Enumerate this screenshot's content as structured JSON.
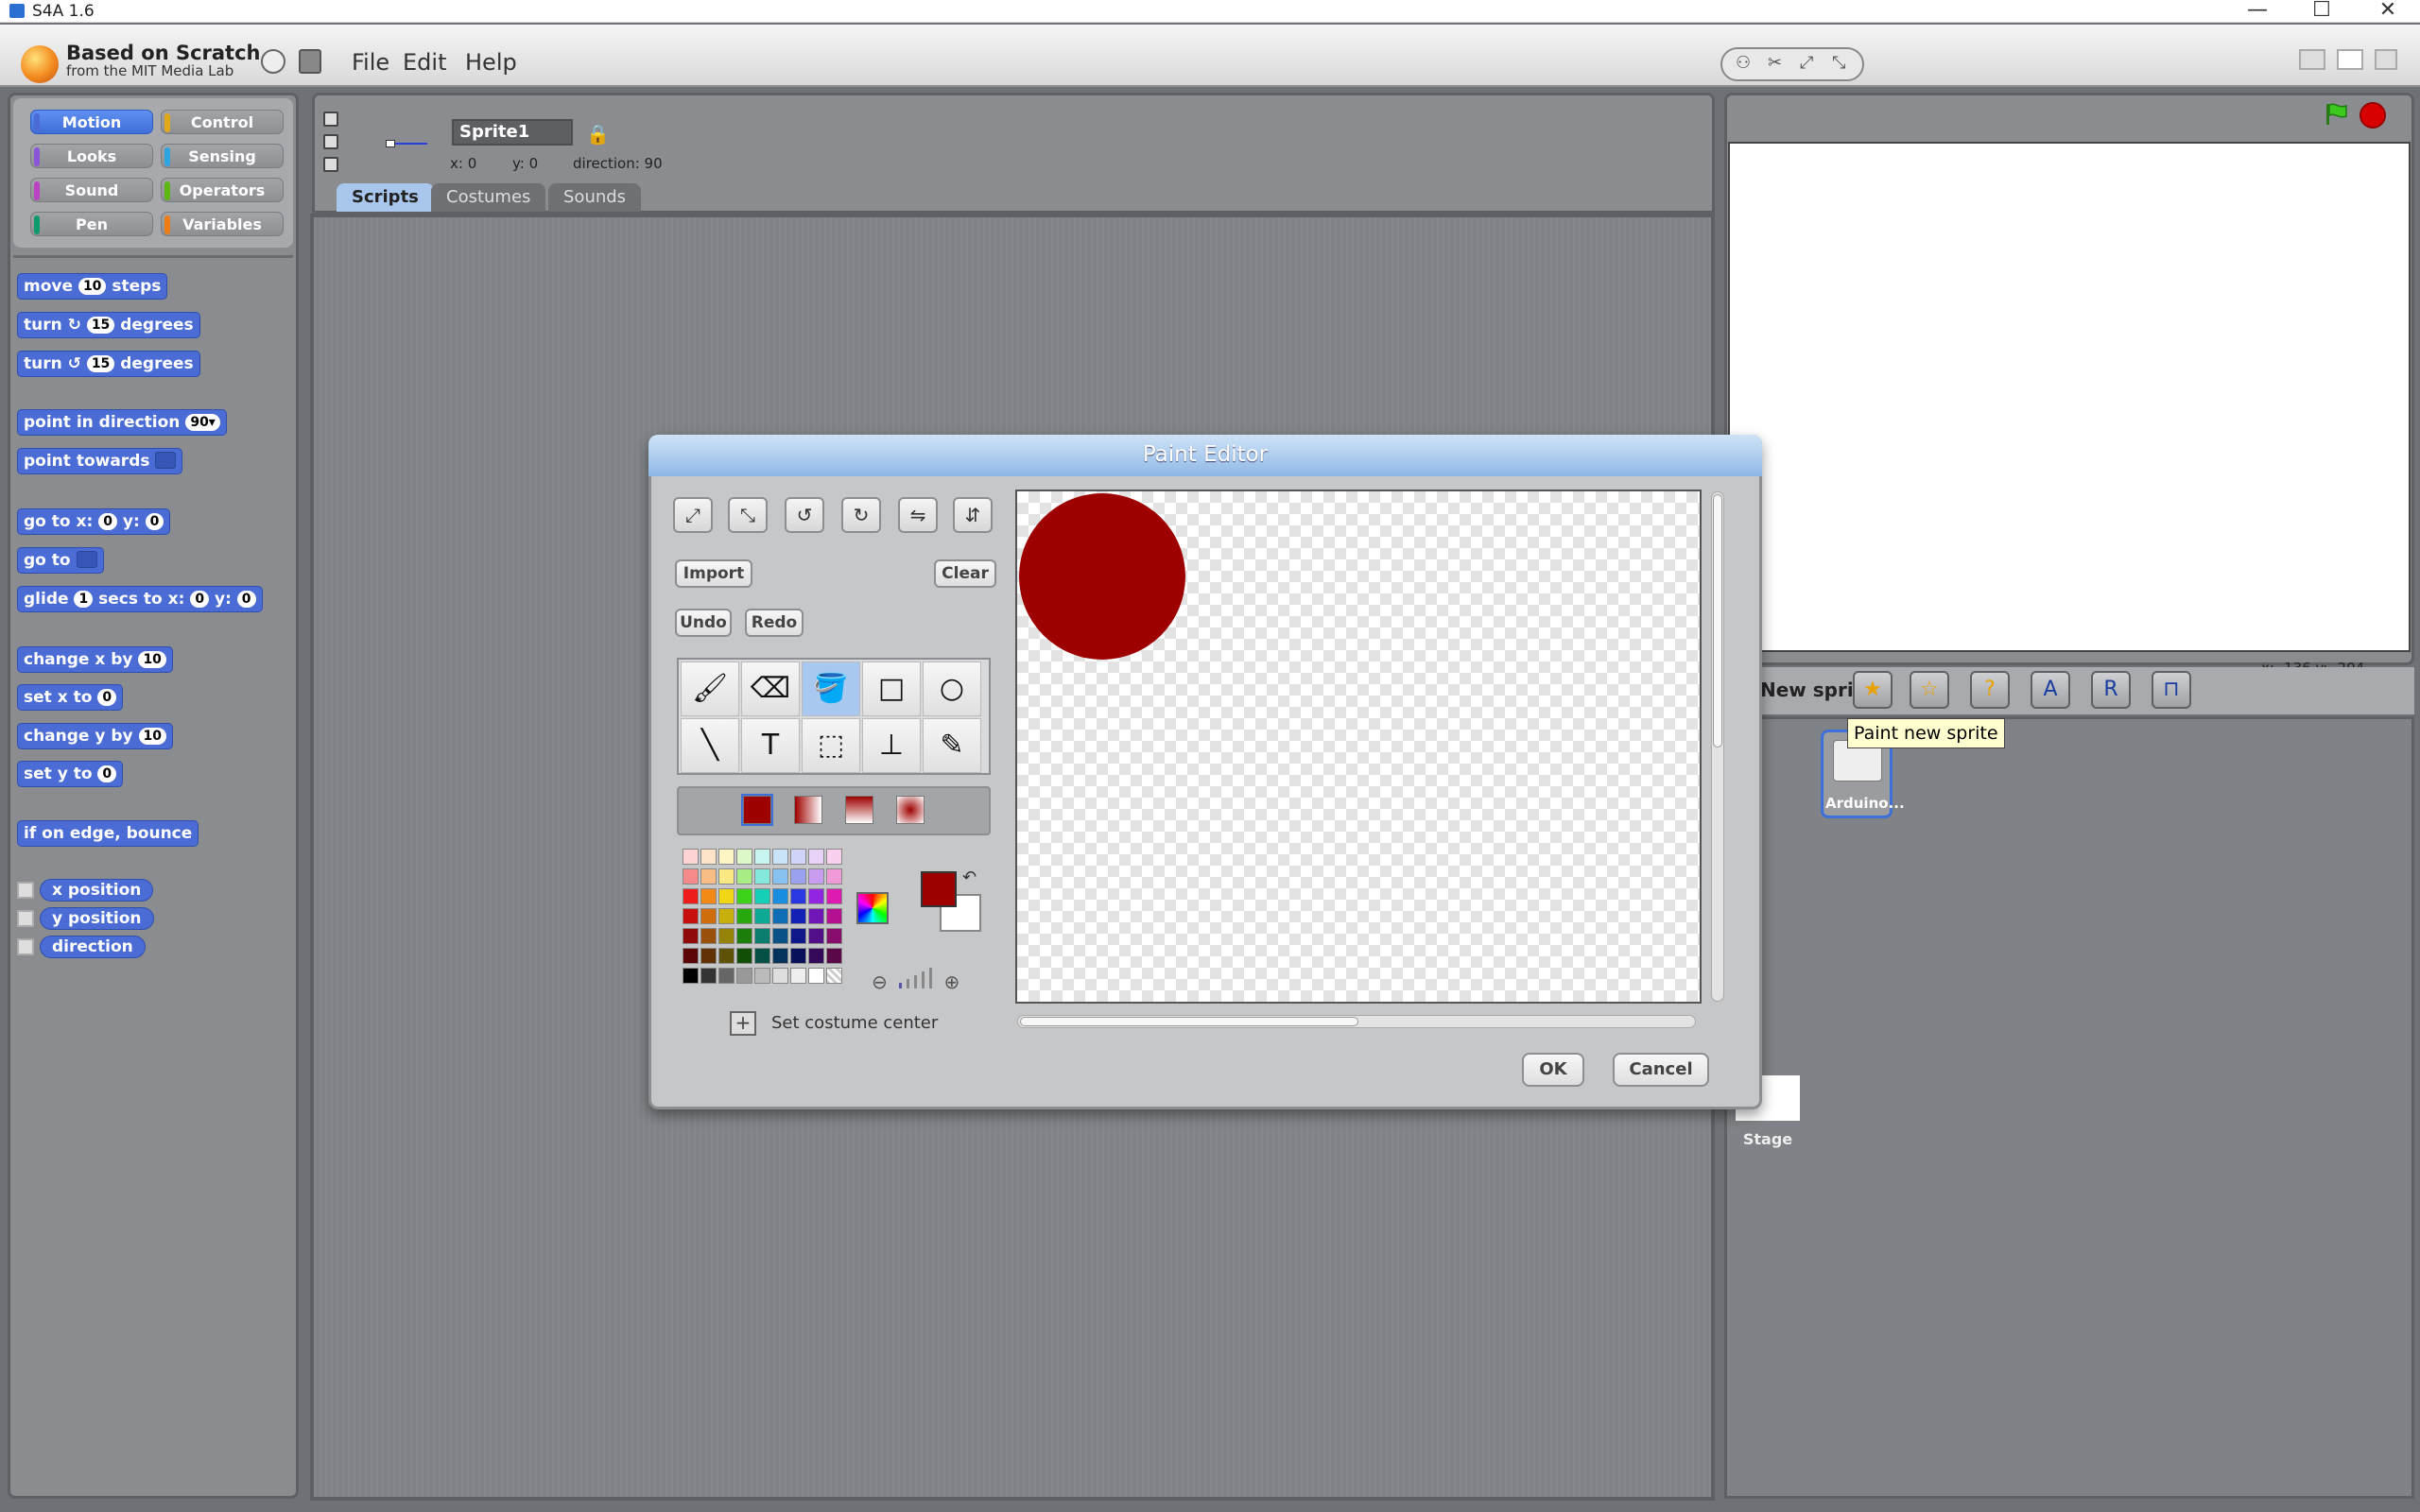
{
  "window": {
    "title": "S4A 1.6",
    "minimize": "—",
    "maximize": "☐",
    "close": "✕"
  },
  "menubar": {
    "logo_line1": "Based on Scratch",
    "logo_line2": "from the MIT Media Lab",
    "items": [
      "File",
      "Edit",
      "Help"
    ]
  },
  "categories": {
    "motion": {
      "label": "Motion",
      "color": "#4a6cd4"
    },
    "control": {
      "label": "Control",
      "color": "#e1a91a"
    },
    "looks": {
      "label": "Looks",
      "color": "#8a55d7"
    },
    "sensing": {
      "label": "Sensing",
      "color": "#2ca5e2"
    },
    "sound": {
      "label": "Sound",
      "color": "#bb42c3"
    },
    "operators": {
      "label": "Operators",
      "color": "#5cb712"
    },
    "pen": {
      "label": "Pen",
      "color": "#0e9a6c"
    },
    "variables": {
      "label": "Variables",
      "color": "#ee7d16"
    }
  },
  "blocks": {
    "move": {
      "pre": "move",
      "val": "10",
      "post": "steps"
    },
    "turn_cw": {
      "pre": "turn",
      "icon": "↻",
      "val": "15",
      "post": "degrees"
    },
    "turn_ccw": {
      "pre": "turn",
      "icon": "↺",
      "val": "15",
      "post": "degrees"
    },
    "point_dir": {
      "pre": "point in direction",
      "val": "90▾"
    },
    "point_towards": {
      "pre": "point towards"
    },
    "goto_xy": {
      "pre": "go to x:",
      "x": "0",
      "mid": "y:",
      "y": "0"
    },
    "goto": {
      "pre": "go to"
    },
    "glide": {
      "pre": "glide",
      "secs": "1",
      "mid": "secs to x:",
      "x": "0",
      "mid2": "y:",
      "y": "0"
    },
    "change_x": {
      "pre": "change x by",
      "val": "10"
    },
    "set_x": {
      "pre": "set x to",
      "val": "0"
    },
    "change_y": {
      "pre": "change y by",
      "val": "10"
    },
    "set_y": {
      "pre": "set y to",
      "val": "0"
    },
    "bounce": {
      "pre": "if on edge, bounce"
    },
    "xpos": "x position",
    "ypos": "y position",
    "direction": "direction"
  },
  "sprite": {
    "name": "Sprite1",
    "x": "x: 0",
    "y": "y: 0",
    "direction": "direction: 90"
  },
  "tabs": {
    "scripts": "Scripts",
    "costumes": "Costumes",
    "sounds": "Sounds"
  },
  "stage": {
    "mouse": "x: -136   y: -204",
    "stage_label": "Stage"
  },
  "newsprite": {
    "label": "New sprite:",
    "tooltip": "Paint new sprite"
  },
  "sprites": [
    {
      "name": "Arduino..."
    }
  ],
  "paint_editor": {
    "title": "Paint Editor",
    "import": "Import",
    "clear": "Clear",
    "undo": "Undo",
    "redo": "Redo",
    "set_center": "Set costume center",
    "ok": "OK",
    "cancel": "Cancel",
    "foreground_color": "#9e0000",
    "background_color": "#ffffff",
    "palette": [
      [
        "#fcd4d4",
        "#fde4c8",
        "#fdf6c4",
        "#ddf7c8",
        "#c8f5ef",
        "#c9e4f8",
        "#d0d4f8",
        "#e8d2f8",
        "#f8d0ee"
      ],
      [
        "#f58a8a",
        "#f8bd85",
        "#f8e985",
        "#a7ec85",
        "#85e8dc",
        "#87c2f1",
        "#9aa2f0",
        "#c89cf0",
        "#f09ad8"
      ],
      [
        "#ef1c1c",
        "#f38a18",
        "#f1d616",
        "#3cd21a",
        "#16cfb7",
        "#1a8de0",
        "#2938e0",
        "#9226e0",
        "#df1ab0"
      ],
      [
        "#c70f0f",
        "#cf6c0d",
        "#c8b00c",
        "#27a90d",
        "#0ca994",
        "#0f6db6",
        "#1421b6",
        "#7015b6",
        "#b5108f"
      ],
      [
        "#8f0a0a",
        "#9a4f0a",
        "#958309",
        "#1c7e0a",
        "#0a7e6e",
        "#0a5187",
        "#0e1888",
        "#520f87",
        "#870c6b"
      ],
      [
        "#5a0606",
        "#613206",
        "#5d5206",
        "#124f06",
        "#064f45",
        "#06335a",
        "#09105a",
        "#35095a",
        "#5a0847"
      ],
      [
        "#000000",
        "#333333",
        "#666666",
        "#999999",
        "#bbbbbb",
        "#dddddd",
        "#eeeeee",
        "#ffffff",
        "transparent"
      ]
    ]
  }
}
